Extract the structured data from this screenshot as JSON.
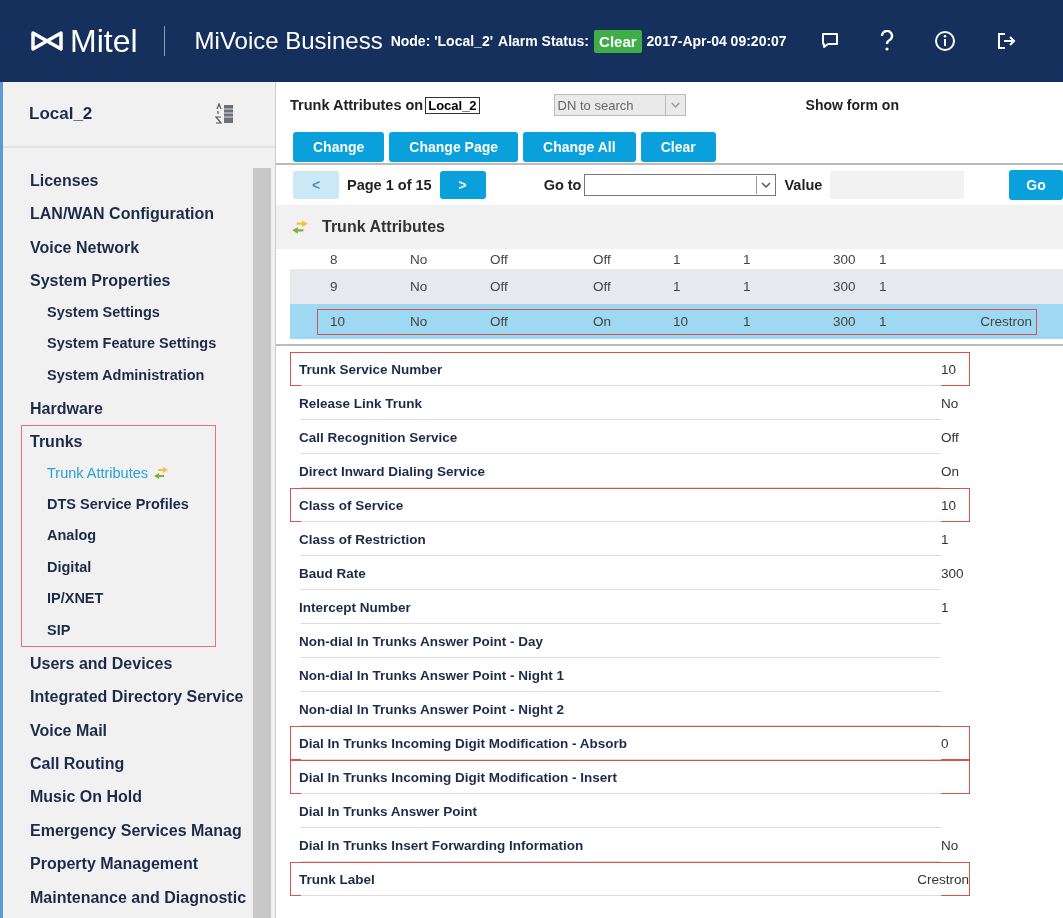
{
  "header": {
    "brand": "Mitel",
    "product": "MiVoice Business",
    "node": "Node: 'Local_2'",
    "alarm_label": "Alarm Status:",
    "alarm_status": "Clear",
    "datetime": "2017-Apr-04 09:20:07"
  },
  "sidebar": {
    "title": "Local_2",
    "items": [
      {
        "label": "Licenses",
        "highlighted": false
      },
      {
        "label": "LAN/WAN Configuration",
        "highlighted": false
      },
      {
        "label": "Voice Network",
        "highlighted": false
      },
      {
        "label": "System Properties",
        "highlighted": false,
        "children": [
          {
            "label": "System Settings",
            "selected": false
          },
          {
            "label": "System Feature Settings",
            "selected": false
          },
          {
            "label": "System Administration",
            "selected": false
          }
        ]
      },
      {
        "label": "Hardware",
        "highlighted": false
      },
      {
        "label": "Trunks",
        "highlighted": true,
        "children": [
          {
            "label": "Trunk Attributes",
            "selected": true
          },
          {
            "label": "DTS Service Profiles",
            "selected": false
          },
          {
            "label": "Analog",
            "selected": false
          },
          {
            "label": "Digital",
            "selected": false
          },
          {
            "label": "IP/XNET",
            "selected": false
          },
          {
            "label": "SIP",
            "selected": false
          }
        ]
      },
      {
        "label": "Users and Devices",
        "highlighted": false
      },
      {
        "label": "Integrated Directory Service",
        "highlighted": false
      },
      {
        "label": "Voice Mail",
        "highlighted": false
      },
      {
        "label": "Call Routing",
        "highlighted": false
      },
      {
        "label": "Music On Hold",
        "highlighted": false
      },
      {
        "label": "Emergency Services Manag",
        "highlighted": false
      },
      {
        "label": "Property Management",
        "highlighted": false
      },
      {
        "label": "Maintenance and Diagnostic",
        "highlighted": false
      }
    ]
  },
  "form_header": {
    "title": "Trunk Attributes on",
    "system": "Local_2",
    "search_placeholder": "DN to search",
    "show_form": "Show form on"
  },
  "buttons": [
    "Change",
    "Change Page",
    "Change All",
    "Clear"
  ],
  "pager": {
    "prev": "<",
    "page": "Page 1 of 15",
    "next": ">",
    "goto": "Go to",
    "value": "Value",
    "go": "Go"
  },
  "section_title": "Trunk Attributes",
  "table": {
    "rows": [
      {
        "cells": [
          "8",
          "No",
          "Off",
          "Off",
          "1",
          "1",
          "300",
          "1"
        ],
        "selected": false,
        "highlighted": false
      },
      {
        "cells": [
          "9",
          "No",
          "Off",
          "Off",
          "1",
          "1",
          "300",
          "1"
        ],
        "selected": false,
        "highlighted": false
      },
      {
        "cells": [
          "10",
          "No",
          "Off",
          "On",
          "10",
          "1",
          "300",
          "1",
          "Crestron"
        ],
        "selected": true,
        "highlighted": true
      }
    ]
  },
  "details": [
    {
      "label": "Trunk Service Number",
      "value": "10",
      "highlighted": true
    },
    {
      "label": "Release Link Trunk",
      "value": "No",
      "highlighted": false
    },
    {
      "label": "Call Recognition Service",
      "value": "Off",
      "highlighted": false
    },
    {
      "label": "Direct Inward Dialing Service",
      "value": "On",
      "highlighted": false
    },
    {
      "label": "Class of Service",
      "value": "10",
      "highlighted": true
    },
    {
      "label": "Class of Restriction",
      "value": "1",
      "highlighted": false
    },
    {
      "label": "Baud Rate",
      "value": "300",
      "highlighted": false
    },
    {
      "label": "Intercept Number",
      "value": "1",
      "highlighted": false
    },
    {
      "label": "Non-dial In Trunks Answer Point - Day",
      "highlighted": false
    },
    {
      "label": "Non-dial In Trunks Answer Point - Night 1",
      "highlighted": false
    },
    {
      "label": "Non-dial In Trunks Answer Point - Night 2",
      "highlighted": false
    },
    {
      "label": "Dial In Trunks Incoming Digit Modification - Absorb",
      "value": "0",
      "highlighted": true
    },
    {
      "label": "Dial In Trunks Incoming Digit Modification - Insert",
      "highlighted": true
    },
    {
      "label": "Dial In Trunks Answer Point",
      "highlighted": false
    },
    {
      "label": "Dial In Trunks Insert Forwarding Information",
      "value": "No",
      "highlighted": false
    },
    {
      "label": "Trunk Label",
      "value": "Crestron",
      "highlighted": true
    }
  ]
}
